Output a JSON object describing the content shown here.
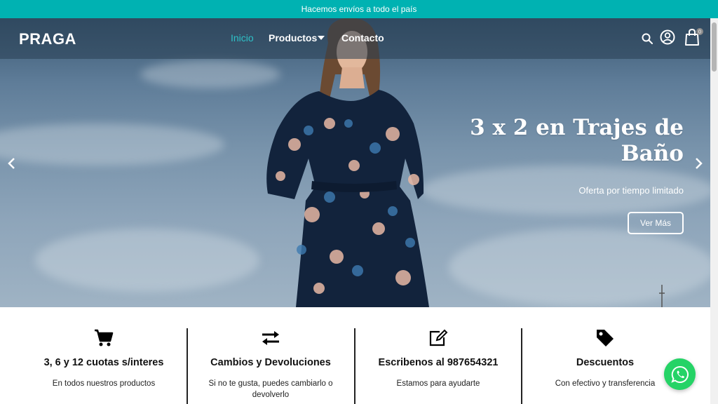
{
  "topbar": {
    "text": "Hacemos envíos a todo el país"
  },
  "nav": {
    "logo": "PRAGA",
    "links": [
      "Inicio",
      "Productos",
      "Contacto"
    ],
    "cart_count": "0"
  },
  "hero": {
    "title": "3 x 2 en Trajes de Baño",
    "subtitle": "Oferta por tiempo limitado",
    "button": "Ver Más"
  },
  "features": [
    {
      "icon": "cart-icon",
      "title": "3, 6 y 12 cuotas s/interes",
      "desc": "En todos nuestros productos"
    },
    {
      "icon": "exchange-icon",
      "title": "Cambios y Devoluciones",
      "desc": "Si no te gusta, puedes cambiarlo o devolverlo"
    },
    {
      "icon": "edit-icon",
      "title": "Escribenos al 987654321",
      "desc": "Estamos para ayudarte"
    },
    {
      "icon": "tag-icon",
      "title": "Descuentos",
      "desc": "Con efectivo y transferencia"
    }
  ],
  "colors": {
    "accent": "#00b2b2",
    "whatsapp": "#25d366"
  }
}
